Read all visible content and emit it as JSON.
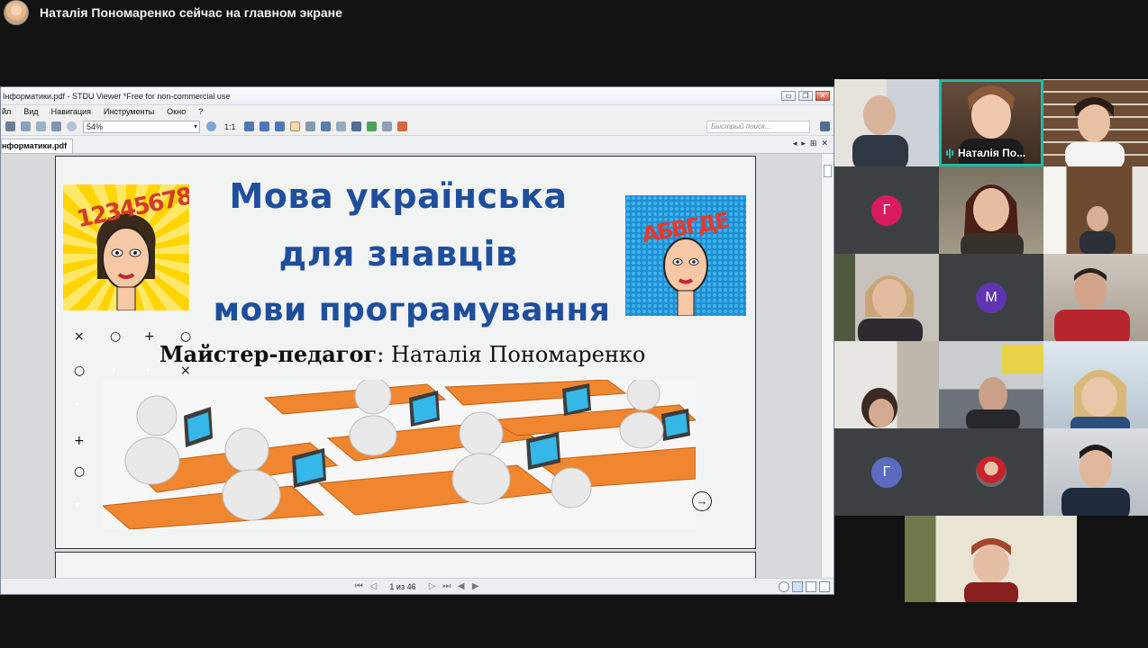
{
  "banner": {
    "text": "Наталія Пономаренко сейчас на главном экране"
  },
  "viewer": {
    "title": "Інформатики.pdf - STDU Viewer *Free for non-commercial use",
    "window_buttons": [
      "▭",
      "❐",
      "✕"
    ],
    "menu": [
      "йл",
      "Вид",
      "Навигация",
      "Инструменты",
      "Окно",
      "?"
    ],
    "toolbar": {
      "zoom_ratio_label": "1:1",
      "zoom_value": "54%",
      "search_placeholder": "Быстрый поиск..."
    },
    "tab": {
      "label": "нформатики.pdf"
    },
    "tab_controls": [
      "◂",
      "▸",
      "⊞",
      "✕"
    ],
    "status": {
      "page_indicator": "1 из 46"
    },
    "colors": {
      "title_blue": "#1f4f9c",
      "orange_desk": "#f0862f",
      "window_border": "#7a8aa0"
    }
  },
  "slide": {
    "title_line1": "Мова українська",
    "title_line2": "для знавців",
    "title_line3": "мови програмування",
    "subtitle_role": "Майстер-педагог",
    "subtitle_name": ": Наталія Пономаренко",
    "left_pop_art_numbers": "1234567890",
    "right_pop_art_letters": "АБВГДЕ",
    "decor_marks": [
      "×",
      "○",
      "+",
      "○",
      "○",
      "•",
      "•",
      "×",
      "•",
      "+",
      "○",
      "•"
    ]
  },
  "participants": [
    {
      "name": "",
      "type": "video",
      "active": false
    },
    {
      "name": "Наталія По...",
      "type": "video",
      "active": true,
      "speaking": true
    },
    {
      "name": "",
      "type": "video",
      "active": false
    },
    {
      "name": "",
      "type": "initial",
      "initial": "Г",
      "color": "#d81b60"
    },
    {
      "name": "",
      "type": "video"
    },
    {
      "name": "",
      "type": "video"
    },
    {
      "name": "",
      "type": "video"
    },
    {
      "name": "",
      "type": "initial",
      "initial": "М",
      "color": "#5e35b1"
    },
    {
      "name": "",
      "type": "video"
    },
    {
      "name": "",
      "type": "video"
    },
    {
      "name": "",
      "type": "video"
    },
    {
      "name": "",
      "type": "video"
    },
    {
      "name": "",
      "type": "initial",
      "initial": "Г",
      "color": "#5c6bc0"
    },
    {
      "name": "",
      "type": "avatar-photo"
    },
    {
      "name": "",
      "type": "video"
    },
    {
      "name": "",
      "type": "video"
    }
  ]
}
